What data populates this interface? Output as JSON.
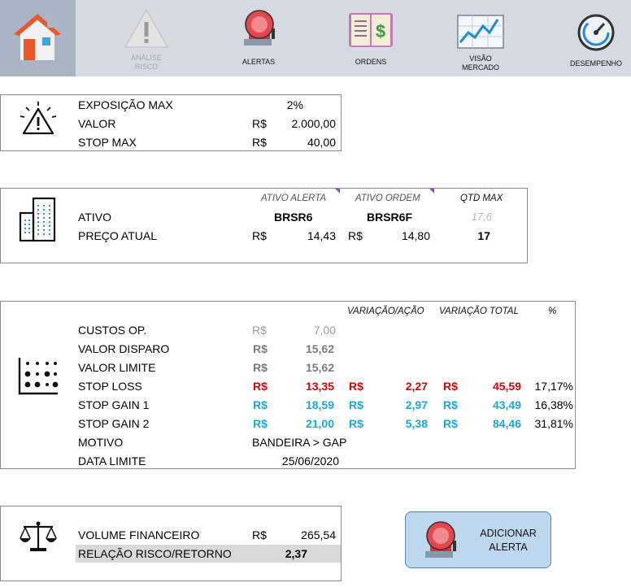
{
  "ribbon": {
    "items": [
      {
        "label": "",
        "icon": "home-icon"
      },
      {
        "label": "ANÁLISE\nRISCO",
        "icon": "warning-icon",
        "disabled": true
      },
      {
        "label": "ALERTAS",
        "icon": "alarm-bell-icon"
      },
      {
        "label": "ORDENS",
        "icon": "ledger-book-icon"
      },
      {
        "label": "VISÃO\nMERCADO",
        "icon": "market-chart-icon"
      },
      {
        "label": "DESEMPENHO",
        "icon": "speedometer-icon"
      }
    ]
  },
  "risk": {
    "exposicao_label": "EXPOSIÇÃO MAX",
    "exposicao_value": "2%",
    "valor_label": "VALOR",
    "valor_currency": "R$",
    "valor_value": "2.000,00",
    "stop_label": "STOP MAX",
    "stop_currency": "R$",
    "stop_value": "40,00"
  },
  "asset": {
    "hdr_alerta": "ATIVO ALERTA",
    "hdr_ordem": "ATIVO ORDEM",
    "hdr_qtd": "QTD MAX",
    "qtd_hint": "17,6",
    "ativo_label": "ATIVO",
    "ativo_alerta": "BRSR6",
    "ativo_ordem": "BRSR6F",
    "preco_label": "PREÇO ATUAL",
    "preco_currency1": "R$",
    "preco_alerta": "14,43",
    "preco_currency2": "R$",
    "preco_ordem": "14,80",
    "qtd_value": "17"
  },
  "levels": {
    "hdr_var_acao": "VARIAÇÃO/AÇÃO",
    "hdr_var_total": "VARIAÇÃO TOTAL",
    "hdr_pct": "%",
    "rows": [
      {
        "label": "CUSTOS OP.",
        "cur": "R$",
        "val": "7,00",
        "cur2": "",
        "var": "",
        "cur3": "",
        "total": "",
        "pct": ""
      },
      {
        "label": "VALOR DISPARO",
        "cur": "R$",
        "val": "15,62",
        "cur2": "",
        "var": "",
        "cur3": "",
        "total": "",
        "pct": ""
      },
      {
        "label": "VALOR LIMITE",
        "cur": "R$",
        "val": "15,62",
        "cur2": "",
        "var": "",
        "cur3": "",
        "total": "",
        "pct": ""
      },
      {
        "label": "STOP LOSS",
        "cur": "R$",
        "val": "13,35",
        "cur2": "R$",
        "var": "2,27",
        "cur3": "R$",
        "total": "45,59",
        "pct": "17,17%"
      },
      {
        "label": "STOP GAIN 1",
        "cur": "R$",
        "val": "18,59",
        "cur2": "R$",
        "var": "2,97",
        "cur3": "R$",
        "total": "43,49",
        "pct": "16,38%"
      },
      {
        "label": "STOP GAIN 2",
        "cur": "R$",
        "val": "21,00",
        "cur2": "R$",
        "var": "5,38",
        "cur3": "R$",
        "total": "84,46",
        "pct": "31,81%"
      }
    ],
    "motivo_label": "MOTIVO",
    "motivo_value": "BANDEIRA > GAP",
    "data_label": "DATA LIMITE",
    "data_value": "25/06/2020"
  },
  "volume": {
    "label": "VOLUME FINANCEIRO",
    "currency": "R$",
    "value": "265,54",
    "ratio_label": "RELAÇÃO RISCO/RETORNO",
    "ratio_value": "2,37"
  },
  "add_alert": {
    "label": "ADICIONAR\nALERTA"
  },
  "colors": {
    "ribbon_bg": "#d5dae2",
    "home_bg": "#a9b4c4",
    "loss_red": "#e00000",
    "gain_blue": "#19a7e0",
    "button_bg": "#bdd7ee"
  }
}
